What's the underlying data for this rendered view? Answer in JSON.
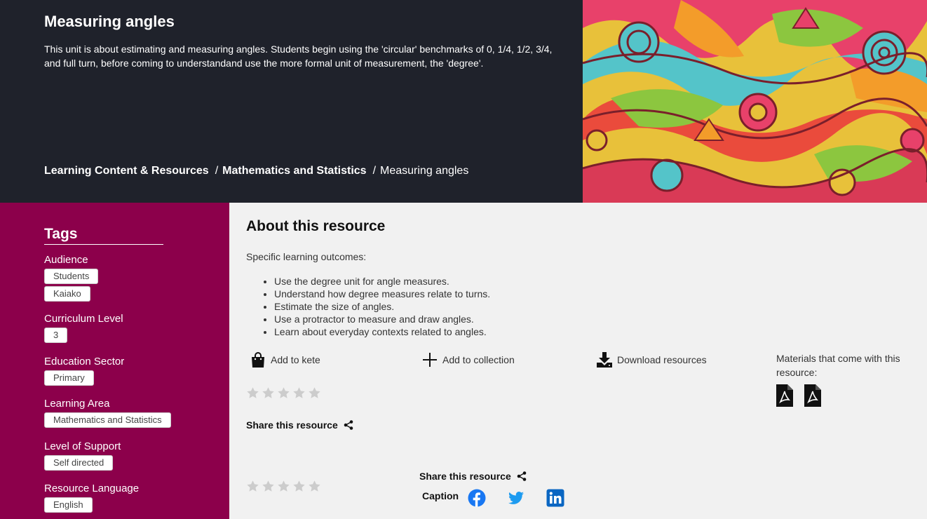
{
  "hero": {
    "title": "Measuring angles",
    "description": "This unit is about estimating and measuring angles. Students begin using the 'circular' benchmarks of 0, 1/4, 1/2, 3/4, and full turn, before coming to understandand use the more formal unit of measurement, the 'degree'."
  },
  "breadcrumb": {
    "items": [
      "Learning Content & Resources",
      "Mathematics and Statistics"
    ],
    "current": "Measuring angles",
    "separator": "/"
  },
  "tags": {
    "heading": "Tags",
    "groups": [
      {
        "label": "Audience",
        "values": [
          "Students",
          "Kaiako"
        ]
      },
      {
        "label": "Curriculum Level",
        "values": [
          "3"
        ]
      },
      {
        "label": "Education Sector",
        "values": [
          "Primary"
        ]
      },
      {
        "label": "Learning Area",
        "values": [
          "Mathematics and Statistics"
        ]
      },
      {
        "label": "Level of Support",
        "values": [
          "Self directed"
        ]
      },
      {
        "label": "Resource Language",
        "values": [
          "English"
        ]
      }
    ]
  },
  "about": {
    "title": "About this resource",
    "outcomes_label": "Specific learning outcomes:",
    "outcomes": [
      "Use the degree unit for angle measures.",
      "Understand how degree measures relate to turns.",
      "Estimate the size of angles.",
      "Use a protractor to measure and draw angles.",
      "Learn about everyday contexts related to angles."
    ]
  },
  "actions": {
    "add_to_kete": "Add to kete",
    "add_to_collection": "Add to collection",
    "download": "Download resources",
    "materials_label": "Materials that come with this resource:"
  },
  "icons": [
    "bag-icon",
    "plus-icon",
    "download-icon",
    "pdf-icon",
    "star-icon",
    "share-icon",
    "facebook-icon",
    "twitter-icon",
    "linkedin-icon"
  ],
  "rating": {
    "stars": 5,
    "filled": 0
  },
  "share": {
    "label": "Share this resource",
    "caption": "Caption"
  },
  "colors": {
    "hero_bg": "#1f222b",
    "sidebar_bg": "#8c004b",
    "main_bg": "#f1f1f1",
    "star_empty": "#cccccc",
    "social_blue": "#0a66c2"
  }
}
